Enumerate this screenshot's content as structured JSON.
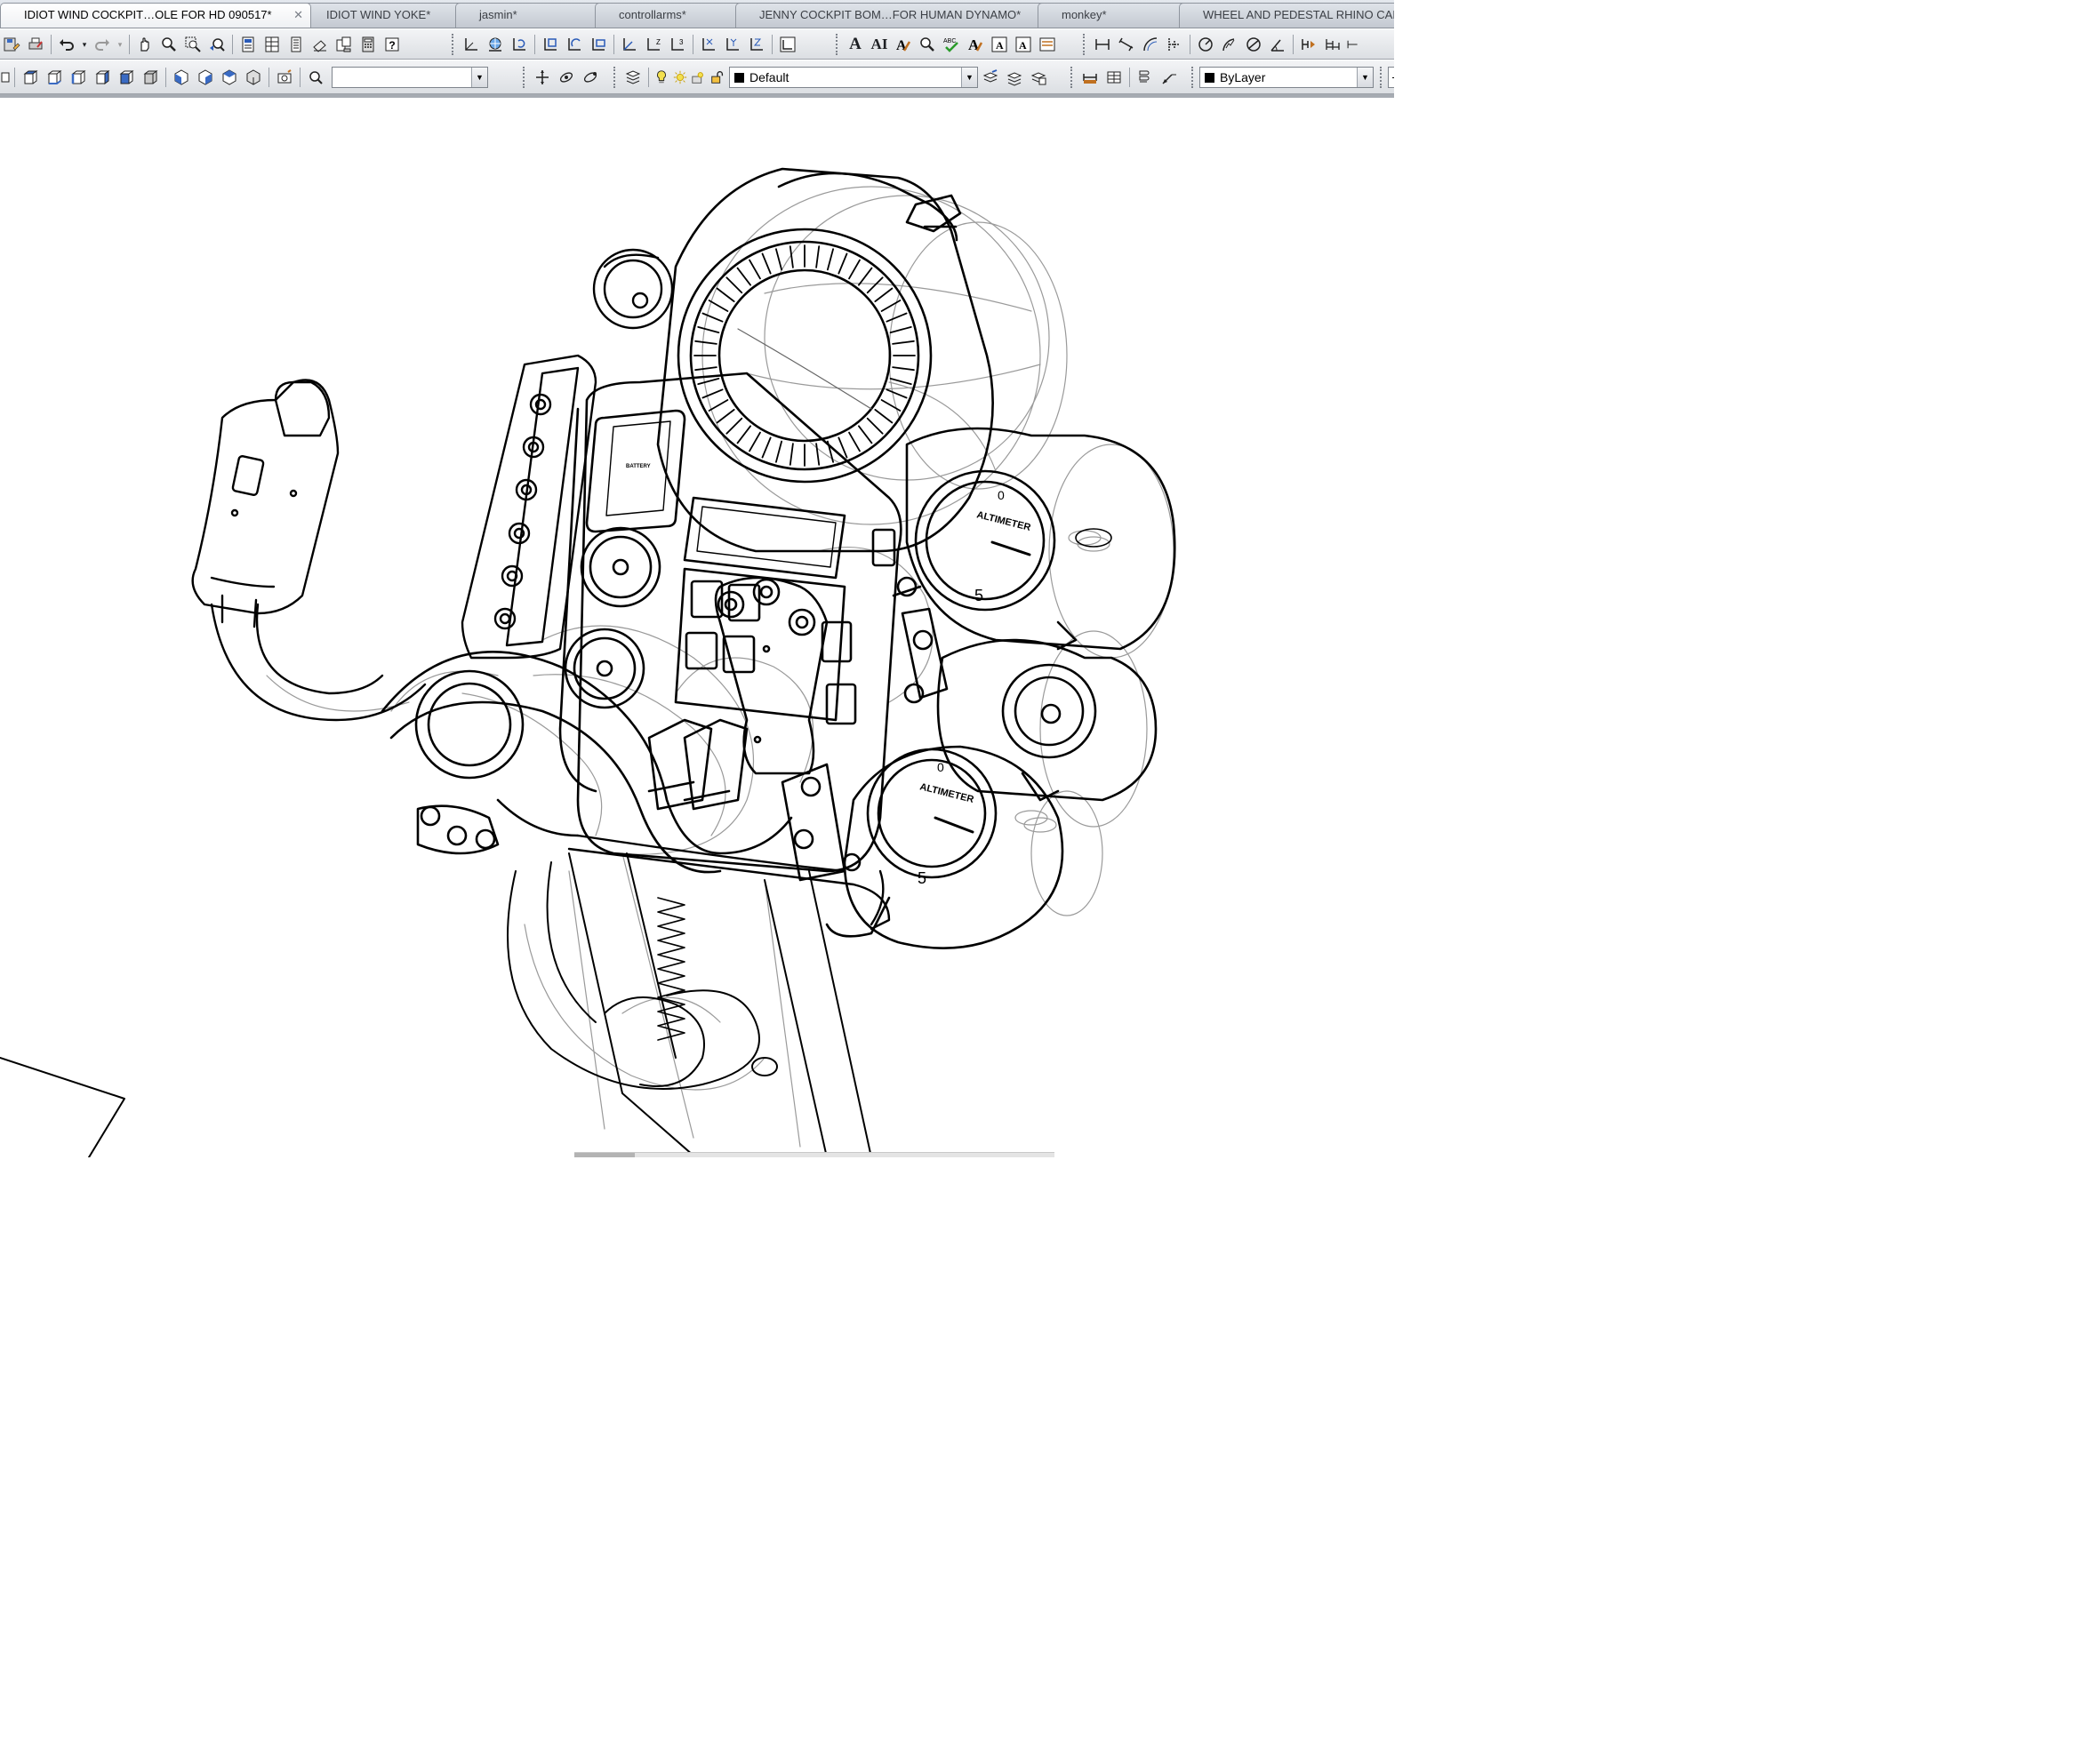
{
  "tabs": [
    {
      "label": "IDIOT WIND COCKPIT…OLE FOR HD 090517*",
      "active": true,
      "close": "✕"
    },
    {
      "label": "IDIOT WIND YOKE*",
      "active": false
    },
    {
      "label": "jasmin*",
      "active": false
    },
    {
      "label": "controllarms*",
      "active": false
    },
    {
      "label": "JENNY COCKPIT BOM…FOR HUMAN DYNAMO*",
      "active": false
    },
    {
      "label": "monkey*",
      "active": false
    },
    {
      "label": "WHEEL AND PEDESTAL RHINO CAD",
      "active": false
    }
  ],
  "toolbar_top": {
    "icons": [
      "save-as-icon",
      "plot-icon",
      "undo-icon",
      "redo-icon",
      "pan-icon",
      "zoom-realtime-icon",
      "zoom-window-icon",
      "zoom-previous-icon",
      "properties-icon",
      "design-center-icon",
      "tool-palettes-icon",
      "markup-icon",
      "sheet-set-icon",
      "quick-calc-icon",
      "help-icon",
      "ucs-icon",
      "ucs-world-icon",
      "ucs-previous-icon",
      "ucs-face-icon",
      "ucs-object-icon",
      "ucs-view-icon",
      "ucs-origin-icon",
      "ucs-zaxis-icon",
      "ucs-3point-icon",
      "ucs-x-icon",
      "ucs-y-icon",
      "ucs-z-icon",
      "ucs-apply-icon",
      "text-icon",
      "multiline-text-icon",
      "edit-text-icon",
      "find-text-icon",
      "spell-check-icon",
      "text-style-icon",
      "scale-text-icon",
      "justify-text-icon",
      "convert-space-icon",
      "dim-linear-icon",
      "dim-aligned-icon",
      "dim-arc-icon",
      "dim-ordinate-icon",
      "dim-radius-icon",
      "dim-jogged-icon",
      "dim-diameter-icon",
      "dim-angular-icon",
      "dim-quick-icon",
      "dim-baseline-icon"
    ],
    "text_glyphs": {
      "text_a": "A",
      "text_ai": "AI",
      "abc": "ABC"
    }
  },
  "toolbar_bottom": {
    "view_combo_value": "",
    "layer_combo_value": "Default",
    "color_combo_value": "ByLayer",
    "combo_arrow": "▼"
  },
  "drawing": {
    "gauge_labels": [
      "ALTIMETER",
      "ALTIMETER"
    ],
    "gauge_numbers": [
      "0",
      "5",
      "0",
      "5"
    ],
    "small_label": "BATTERY"
  }
}
